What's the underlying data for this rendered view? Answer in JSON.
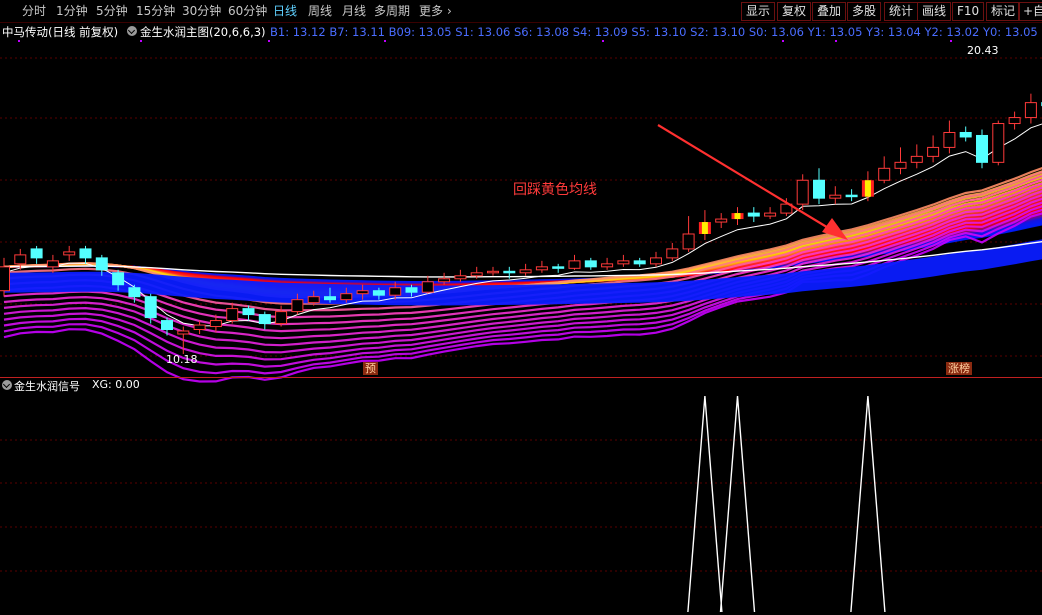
{
  "toolbar": {
    "periods": [
      "分时",
      "1分钟",
      "5分钟",
      "15分钟",
      "30分钟",
      "60分钟",
      "日线",
      "周线",
      "月线",
      "多周期",
      "更多"
    ],
    "active_period": "日线",
    "buttons": [
      "显示",
      "复权",
      "叠加",
      "多股",
      "统计",
      "画线",
      "F10",
      "标记",
      "+自"
    ]
  },
  "stock": {
    "title": "中马传动(日线 前复权)",
    "indicator_main": "金生水润主图(20,6,6,3)",
    "indicator_values": "B1: 13.12  B7: 13.11  B09: 13.05  S1: 13.06  S6: 13.08  S4: 13.09  S5: 13.10  S2: 13.10  S0: 13.06  Y1: 13.05  Y3: 13.04  Y2: 13.02  Y0: 13.05"
  },
  "annotations": {
    "high": "20.43",
    "low": "10.18",
    "note": "回踩黄色均线",
    "marker_yu": "预",
    "marker_zhangting": "涨榜"
  },
  "sub_pane": {
    "title": "金生水润信号",
    "xg_label": "XG: 0.00"
  },
  "colors": {
    "background": "#000000",
    "up": "#ff3a3a",
    "down": "#54ffff",
    "accent": "#5fd0ff",
    "grid": "#5a0000",
    "note": "#ff3a3a"
  },
  "chart_data": {
    "type": "candlestick",
    "price_high": 20.43,
    "price_low": 10.18,
    "candles": [
      [
        12.3,
        13.1,
        13.4,
        12.1
      ],
      [
        13.2,
        13.5,
        13.7,
        13.0
      ],
      [
        13.7,
        13.4,
        13.8,
        13.2
      ],
      [
        13.1,
        13.3,
        13.5,
        12.9
      ],
      [
        13.5,
        13.6,
        13.8,
        13.3
      ],
      [
        13.7,
        13.4,
        13.8,
        13.2
      ],
      [
        13.4,
        13.0,
        13.5,
        12.8
      ],
      [
        12.9,
        12.5,
        13.0,
        12.3
      ],
      [
        12.4,
        12.1,
        12.5,
        11.9
      ],
      [
        12.1,
        11.4,
        12.2,
        11.2
      ],
      [
        11.3,
        11.0,
        11.4,
        10.8
      ],
      [
        10.85,
        10.95,
        11.1,
        10.18
      ],
      [
        11.0,
        11.15,
        11.3,
        10.85
      ],
      [
        11.1,
        11.3,
        11.5,
        10.9
      ],
      [
        11.3,
        11.7,
        11.9,
        11.2
      ],
      [
        11.7,
        11.5,
        11.8,
        11.3
      ],
      [
        11.5,
        11.2,
        11.6,
        11.0
      ],
      [
        11.2,
        11.6,
        11.8,
        11.1
      ],
      [
        11.6,
        12.0,
        12.2,
        11.5
      ],
      [
        11.9,
        12.1,
        12.3,
        11.8
      ],
      [
        12.1,
        12.0,
        12.4,
        11.9
      ],
      [
        12.0,
        12.2,
        12.4,
        11.9
      ],
      [
        12.2,
        12.3,
        12.5,
        12.0
      ],
      [
        12.3,
        12.15,
        12.4,
        12.0
      ],
      [
        12.15,
        12.4,
        12.6,
        12.0
      ],
      [
        12.4,
        12.25,
        12.5,
        12.1
      ],
      [
        12.25,
        12.6,
        12.8,
        12.2
      ],
      [
        12.6,
        12.7,
        12.9,
        12.5
      ],
      [
        12.7,
        12.8,
        13.0,
        12.6
      ],
      [
        12.8,
        12.9,
        13.1,
        12.7
      ],
      [
        12.9,
        12.95,
        13.1,
        12.8
      ],
      [
        12.95,
        12.9,
        13.1,
        12.7
      ],
      [
        12.9,
        13.0,
        13.2,
        12.8
      ],
      [
        13.0,
        13.1,
        13.3,
        12.9
      ],
      [
        13.1,
        13.05,
        13.2,
        12.9
      ],
      [
        13.05,
        13.3,
        13.5,
        13.0
      ],
      [
        13.3,
        13.1,
        13.4,
        13.0
      ],
      [
        13.1,
        13.2,
        13.4,
        13.0
      ],
      [
        13.2,
        13.3,
        13.5,
        13.1
      ],
      [
        13.3,
        13.2,
        13.4,
        13.1
      ],
      [
        13.2,
        13.4,
        13.6,
        13.1
      ],
      [
        13.4,
        13.7,
        13.9,
        13.3
      ],
      [
        13.7,
        14.2,
        14.8,
        13.6
      ],
      [
        14.2,
        14.6,
        15.0,
        14.0
      ],
      [
        14.6,
        14.7,
        14.9,
        14.4
      ],
      [
        14.7,
        14.9,
        15.1,
        14.5
      ],
      [
        14.9,
        14.8,
        15.1,
        14.6
      ],
      [
        14.8,
        14.9,
        15.1,
        14.7
      ],
      [
        14.9,
        15.2,
        15.4,
        14.8
      ],
      [
        15.2,
        16.0,
        16.2,
        15.0
      ],
      [
        16.0,
        15.4,
        16.4,
        15.2
      ],
      [
        15.4,
        15.5,
        15.8,
        15.2
      ],
      [
        15.5,
        15.45,
        15.7,
        15.3
      ],
      [
        15.45,
        16.0,
        16.3,
        15.3
      ],
      [
        16.0,
        16.4,
        16.8,
        15.9
      ],
      [
        16.4,
        16.6,
        17.1,
        16.2
      ],
      [
        16.6,
        16.8,
        17.2,
        16.4
      ],
      [
        16.8,
        17.1,
        17.5,
        16.6
      ],
      [
        17.1,
        17.6,
        18.0,
        16.9
      ],
      [
        17.6,
        17.45,
        17.8,
        17.3
      ],
      [
        17.5,
        16.6,
        17.7,
        16.4
      ],
      [
        16.6,
        17.9,
        18.0,
        16.5
      ],
      [
        17.9,
        18.1,
        18.3,
        17.7
      ],
      [
        18.1,
        18.6,
        18.9,
        17.9
      ],
      [
        18.6,
        18.5,
        18.9,
        18.3
      ],
      [
        18.5,
        19.0,
        19.3,
        18.4
      ],
      [
        19.0,
        19.3,
        19.6,
        18.8
      ],
      [
        19.3,
        20.2,
        20.43,
        19.2
      ],
      [
        20.2,
        19.4,
        20.3,
        19.0
      ]
    ],
    "signals": [
      43,
      45,
      53
    ]
  }
}
